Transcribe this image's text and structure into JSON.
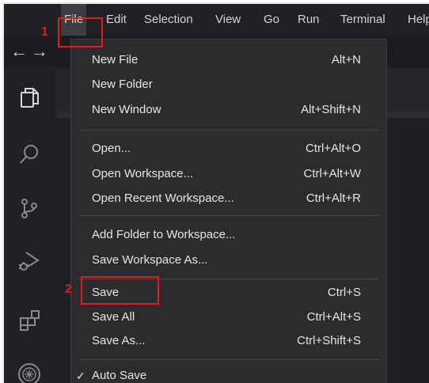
{
  "menubar": {
    "items": [
      "File",
      "Edit",
      "Selection",
      "View",
      "Go",
      "Run",
      "Terminal",
      "Help"
    ]
  },
  "file_menu": {
    "groups": [
      [
        {
          "label": "New File",
          "shortcut": "Alt+N"
        },
        {
          "label": "New Folder",
          "shortcut": ""
        },
        {
          "label": "New Window",
          "shortcut": "Alt+Shift+N"
        }
      ],
      [
        {
          "label": "Open...",
          "shortcut": "Ctrl+Alt+O"
        },
        {
          "label": "Open Workspace...",
          "shortcut": "Ctrl+Alt+W"
        },
        {
          "label": "Open Recent Workspace...",
          "shortcut": "Ctrl+Alt+R"
        }
      ],
      [
        {
          "label": "Add Folder to Workspace...",
          "shortcut": ""
        },
        {
          "label": "Save Workspace As...",
          "shortcut": ""
        }
      ],
      [
        {
          "label": "Save",
          "shortcut": "Ctrl+S"
        },
        {
          "label": "Save All",
          "shortcut": "Ctrl+Alt+S"
        },
        {
          "label": "Save As...",
          "shortcut": "Ctrl+Shift+S"
        }
      ],
      [
        {
          "label": "Auto Save",
          "shortcut": "",
          "checked": true,
          "check_glyph": "✓"
        }
      ]
    ]
  },
  "nav": {
    "back_glyph": "←",
    "forward_glyph": "→"
  },
  "activity_icons": [
    "explorer-icon",
    "search-icon",
    "source-control-icon",
    "run-debug-icon",
    "extensions-icon",
    "account-icon"
  ],
  "annotations": {
    "step1": "1",
    "step2": "2",
    "color": "#e51b1b"
  }
}
